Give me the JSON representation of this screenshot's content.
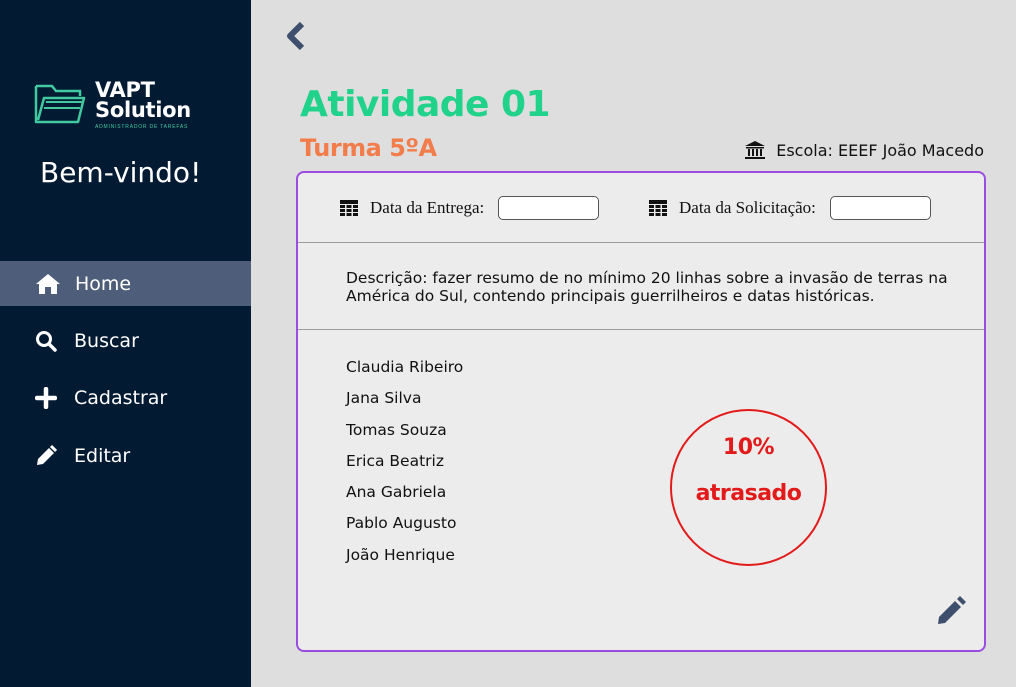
{
  "sidebar": {
    "logo": {
      "line1": "VAPT",
      "line2": "Solution",
      "tagline": "ADMINISTRADOR DE TAREFAS"
    },
    "welcome": "Bem-vindo!",
    "items": [
      {
        "label": "Home",
        "icon": "home-icon",
        "active": true
      },
      {
        "label": "Buscar",
        "icon": "search-icon",
        "active": false
      },
      {
        "label": "Cadastrar",
        "icon": "plus-icon",
        "active": false
      },
      {
        "label": "Editar",
        "icon": "pencil-icon",
        "active": false
      }
    ]
  },
  "header": {
    "title": "Atividade 01",
    "subtitle": "Turma 5ºA",
    "school": "Escola: EEEF João Macedo"
  },
  "card": {
    "delivery_label": "Data da Entrega:",
    "delivery_value": "",
    "request_label": "Data da Solicitação:",
    "request_value": "",
    "description": "Descrição: fazer resumo de no mínimo 20 linhas sobre a invasão de terras na América do Sul, contendo principais guerrilheiros e datas históricas.",
    "students": [
      "Claudia Ribeiro",
      "Jana Silva",
      "Tomas Souza",
      "Erica Beatriz",
      "Ana Gabriela",
      "Pablo Augusto",
      "João Henrique"
    ],
    "status": {
      "percent": "10%",
      "label": "atrasado"
    }
  },
  "colors": {
    "sidebar_bg": "#031a33",
    "active_item_bg": "#4e5e7a",
    "title": "#21d28a",
    "subtitle": "#f27d4b",
    "card_border": "#9b4de0",
    "status": "#e31a1a"
  }
}
